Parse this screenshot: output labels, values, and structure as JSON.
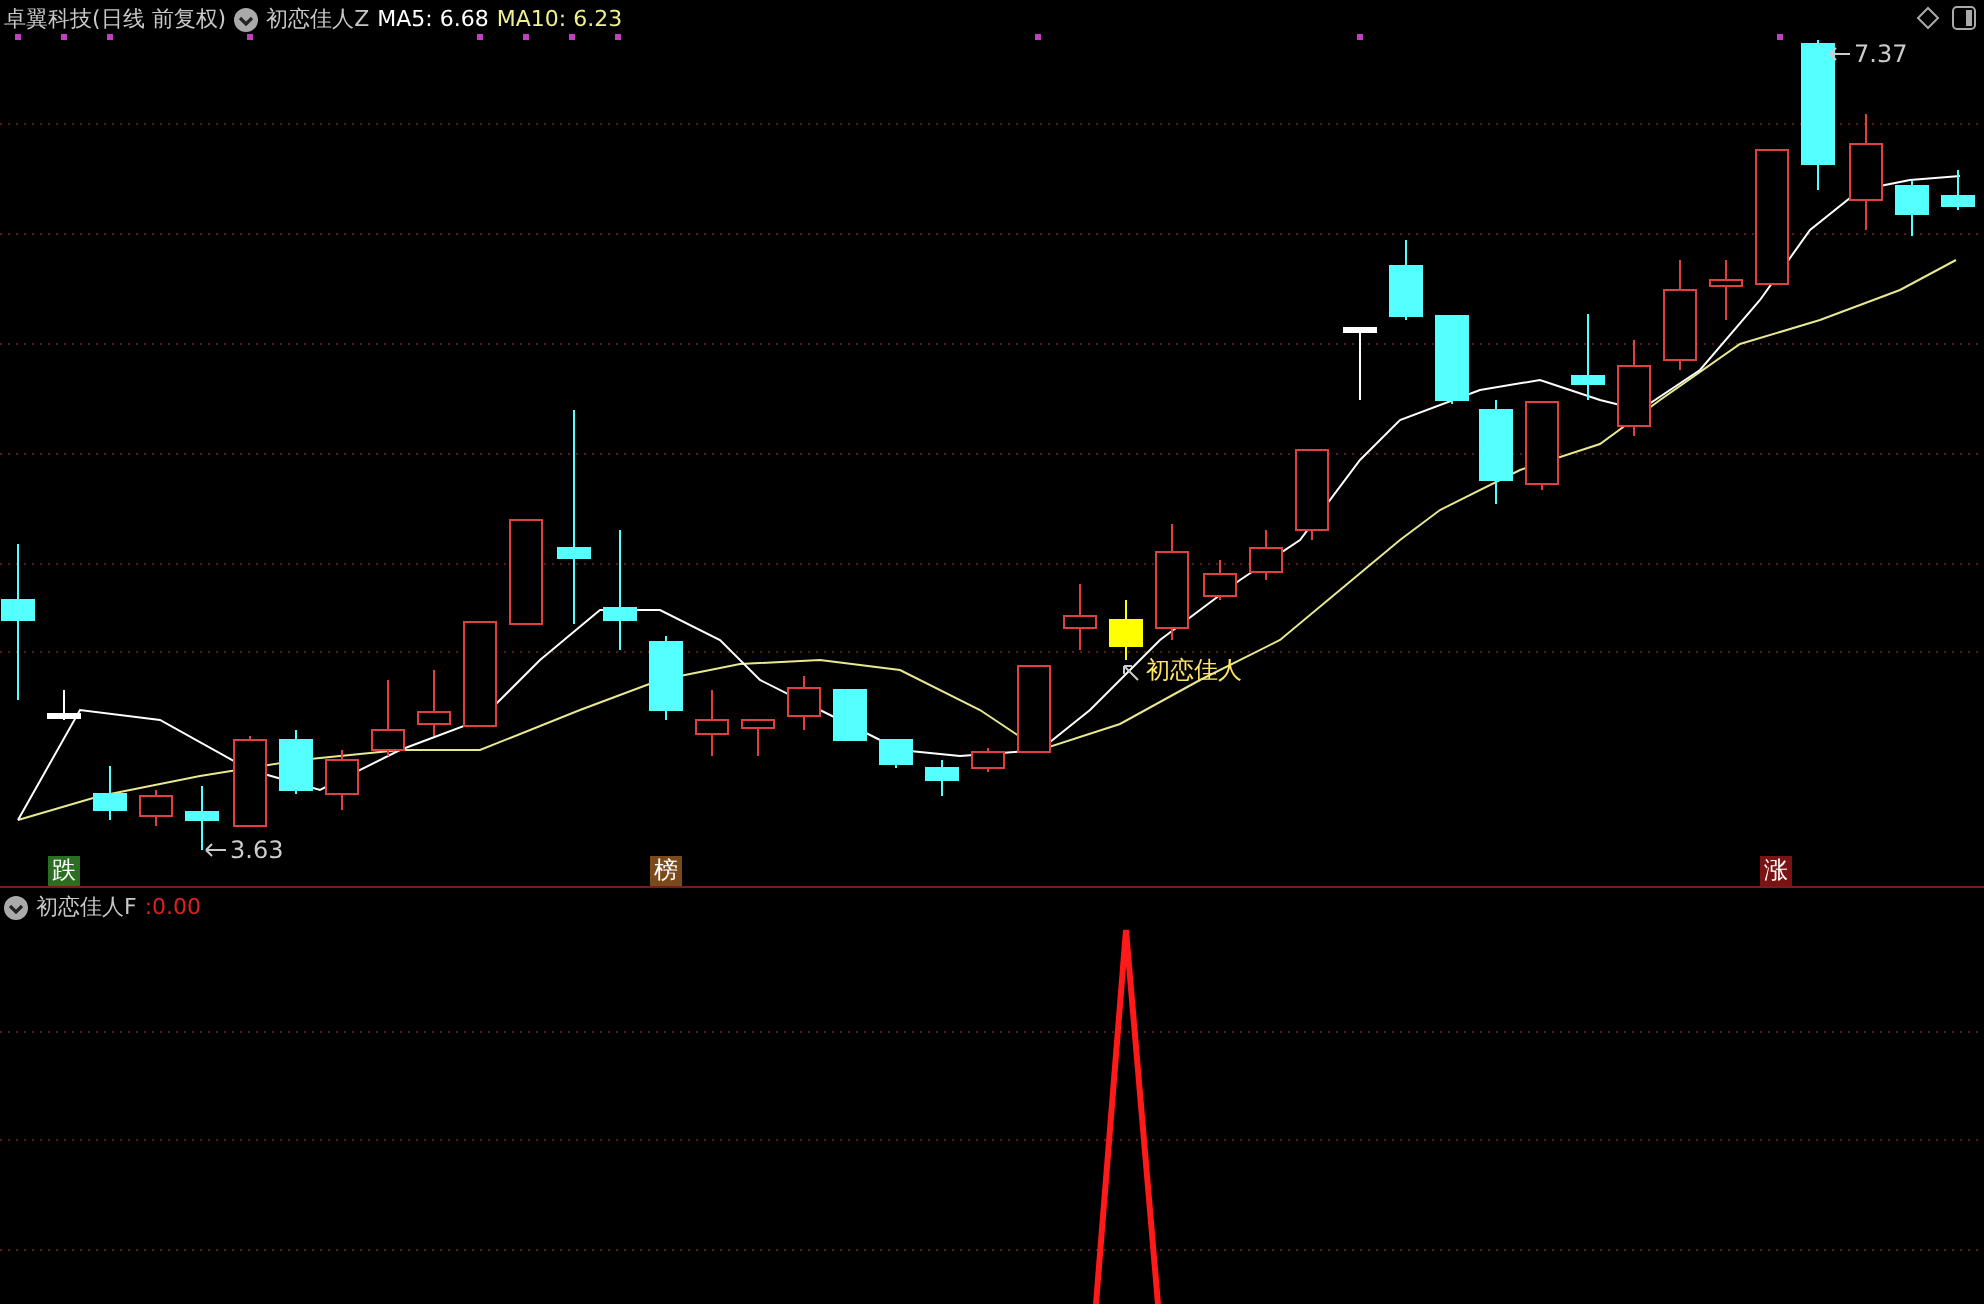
{
  "main_panel": {
    "title": "卓翼科技(日线 前复权)",
    "indicator": "初恋佳人Z",
    "ma5": {
      "label": "MA5:",
      "value": "6.68"
    },
    "ma10": {
      "label": "MA10:",
      "value": "6.23"
    },
    "price_marks": [
      {
        "kind": "low",
        "text": "3.63"
      },
      {
        "kind": "high",
        "text": "7.37"
      }
    ],
    "signal_label": {
      "text": "初恋佳人"
    },
    "badges": [
      {
        "text": "跌",
        "color": "#2a6e22"
      },
      {
        "text": "榜",
        "color": "#7a4a1c"
      },
      {
        "text": "涨",
        "color": "#7a1414"
      }
    ]
  },
  "sub_panel": {
    "title": "初恋佳人F",
    "value": ":0.00"
  }
}
